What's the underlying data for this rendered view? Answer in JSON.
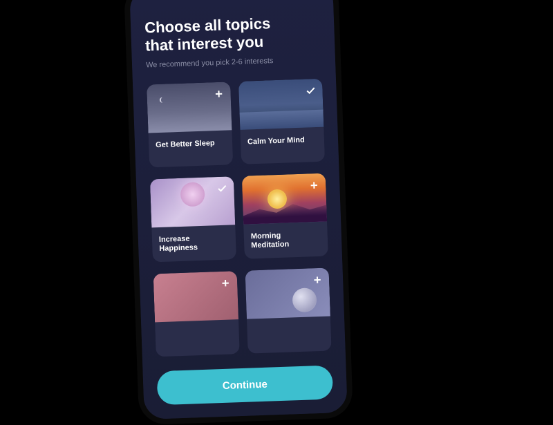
{
  "heading_line1": "Choose all topics",
  "heading_line2": "that interest you",
  "subheading": "We recommend you pick 2-6 interests",
  "topics": [
    {
      "label": "Get Better Sleep",
      "selected": false,
      "image": "sleep"
    },
    {
      "label": "Calm Your Mind",
      "selected": true,
      "image": "calm"
    },
    {
      "label": "Increase Happiness",
      "selected": true,
      "image": "happy"
    },
    {
      "label": "Morning Meditation",
      "selected": false,
      "image": "morning"
    },
    {
      "label": "",
      "selected": false,
      "image": "blank1"
    },
    {
      "label": "",
      "selected": false,
      "image": "blank2"
    }
  ],
  "continue_label": "Continue",
  "colors": {
    "background": "#1a1d35",
    "accent": "#3dbfcf",
    "text": "#ffffff",
    "subtext": "#8a8da5"
  }
}
